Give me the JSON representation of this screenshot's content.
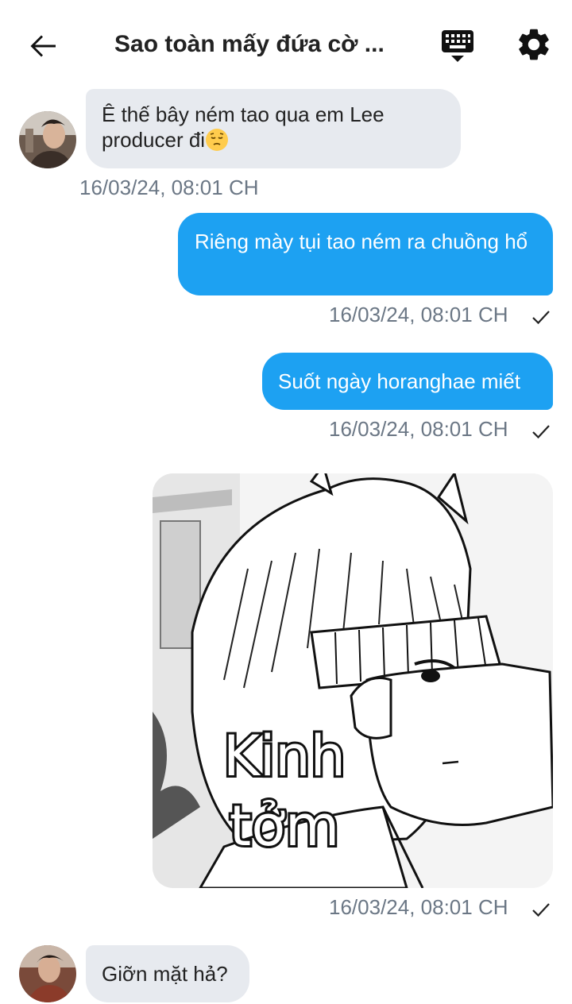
{
  "header": {
    "title": "Sao toàn mấy đứa cờ ...",
    "back_icon": "arrow-left-icon",
    "keyboard_icon": "keyboard-icon",
    "settings_icon": "gear-icon"
  },
  "messages": [
    {
      "direction": "incoming",
      "text": "Ê thế bây ném tao qua em Lee producer đi",
      "emoji": "pensive-face",
      "timestamp": "16/03/24, 08:01 CH"
    },
    {
      "direction": "outgoing",
      "text": "Riêng mày tụi tao ném ra chuồng hổ",
      "timestamp": "16/03/24, 08:01 CH",
      "status": "sent"
    },
    {
      "direction": "outgoing",
      "text": "Suốt ngày horanghae miết",
      "timestamp": "16/03/24, 08:01 CH",
      "status": "sent"
    },
    {
      "direction": "outgoing",
      "type": "image",
      "image_caption": "Kinh tởm",
      "timestamp": "16/03/24, 08:01 CH",
      "status": "sent"
    },
    {
      "direction": "incoming",
      "text": "Giỡn mặt hả?"
    }
  ],
  "colors": {
    "outgoing_bubble": "#1da1f2",
    "incoming_bubble": "#e7eaef",
    "timestamp": "#6b7785"
  }
}
